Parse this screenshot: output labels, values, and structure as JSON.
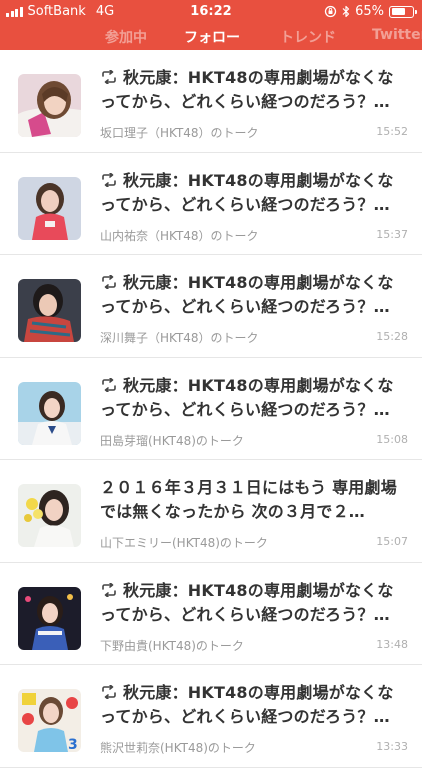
{
  "status_bar": {
    "carrier": "SoftBank",
    "network": "4G",
    "time": "16:22",
    "battery": "65%",
    "battery_level": 0.65
  },
  "tabs": [
    "参加中",
    "フォロー",
    "トレンド",
    "Twitter"
  ],
  "active_tab": "フォロー",
  "colors": {
    "header": "#e8503f"
  },
  "items": [
    {
      "title": "秋元康：HKT48の専用劇場がなくなってから、どれくらい経つのだろう？…",
      "retweet": true,
      "source": "坂口理子（HKT48）のトーク",
      "time": "15:52"
    },
    {
      "title": "秋元康：HKT48の専用劇場がなくなってから、どれくらい経つのだろう？…",
      "retweet": true,
      "source": "山内祐奈（HKT48）のトーク",
      "time": "15:37"
    },
    {
      "title": "秋元康：HKT48の専用劇場がなくなってから、どれくらい経つのだろう？…",
      "retweet": true,
      "source": "深川舞子（HKT48）のトーク",
      "time": "15:28"
    },
    {
      "title": "秋元康：HKT48の専用劇場がなくなってから、どれくらい経つのだろう？…",
      "retweet": true,
      "source": "田島芽瑠(HKT48)のトーク",
      "time": "15:08"
    },
    {
      "title": "２０１６年３月３１日にはもう 専用劇場では無くなったから 次の３月で２…",
      "retweet": false,
      "source": "山下エミリー(HKT48)のトーク",
      "time": "15:07"
    },
    {
      "title": "秋元康：HKT48の専用劇場がなくなってから、どれくらい経つのだろう？…",
      "retweet": true,
      "source": "下野由貴(HKT48)のトーク",
      "time": "13:48"
    },
    {
      "title": "秋元康：HKT48の専用劇場がなくなってから、どれくらい経つのだろう？…",
      "retweet": true,
      "source": "熊沢世莉奈(HKT48)のトーク",
      "time": "13:33"
    }
  ]
}
